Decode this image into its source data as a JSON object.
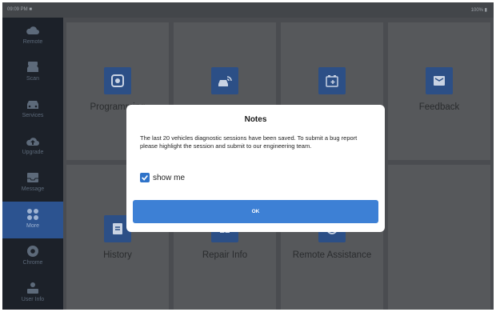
{
  "statusbar": {
    "left_text": "09:09 PM ■",
    "right_text": "100% ▮"
  },
  "sidebar": {
    "items": [
      {
        "label": "Remote",
        "icon": "cloud-icon"
      },
      {
        "label": "Scan",
        "icon": "car-scan-icon"
      },
      {
        "label": "Services",
        "icon": "car-service-icon"
      },
      {
        "label": "Upgrade",
        "icon": "cloud-upload-icon"
      },
      {
        "label": "Message",
        "icon": "message-icon"
      },
      {
        "label": "More",
        "icon": "grid-icon",
        "active": true
      },
      {
        "label": "Chrome",
        "icon": "chrome-icon"
      },
      {
        "label": "User Info",
        "icon": "user-info-icon"
      }
    ]
  },
  "tiles": {
    "programming": {
      "label": "Programming",
      "icon": "program-icon"
    },
    "tile2": {
      "label": "",
      "icon": "car-wifi-icon"
    },
    "tile3": {
      "label": "",
      "icon": "battery-icon"
    },
    "feedback": {
      "label": "Feedback",
      "icon": "feedback-icon"
    },
    "history": {
      "label": "History",
      "icon": "history-icon"
    },
    "repair_info": {
      "label": "Repair Info",
      "icon": "repair-info-icon"
    },
    "remote_assistance": {
      "label": "Remote Assistance",
      "icon": "remote-assistance-icon"
    }
  },
  "dialog": {
    "title": "Notes",
    "message": "The last 20 vehicles diagnostic sessions have been saved. To submit a bug report please highlight the session and submit to our engineering team.",
    "checkbox_label": "show me",
    "checkbox_checked": true,
    "ok_label": "OK"
  },
  "colors": {
    "accent": "#3d80d5",
    "sidebar_bg": "#1c2129",
    "sidebar_active": "#2c5390",
    "tile_icon_bg": "#2c4f86"
  }
}
